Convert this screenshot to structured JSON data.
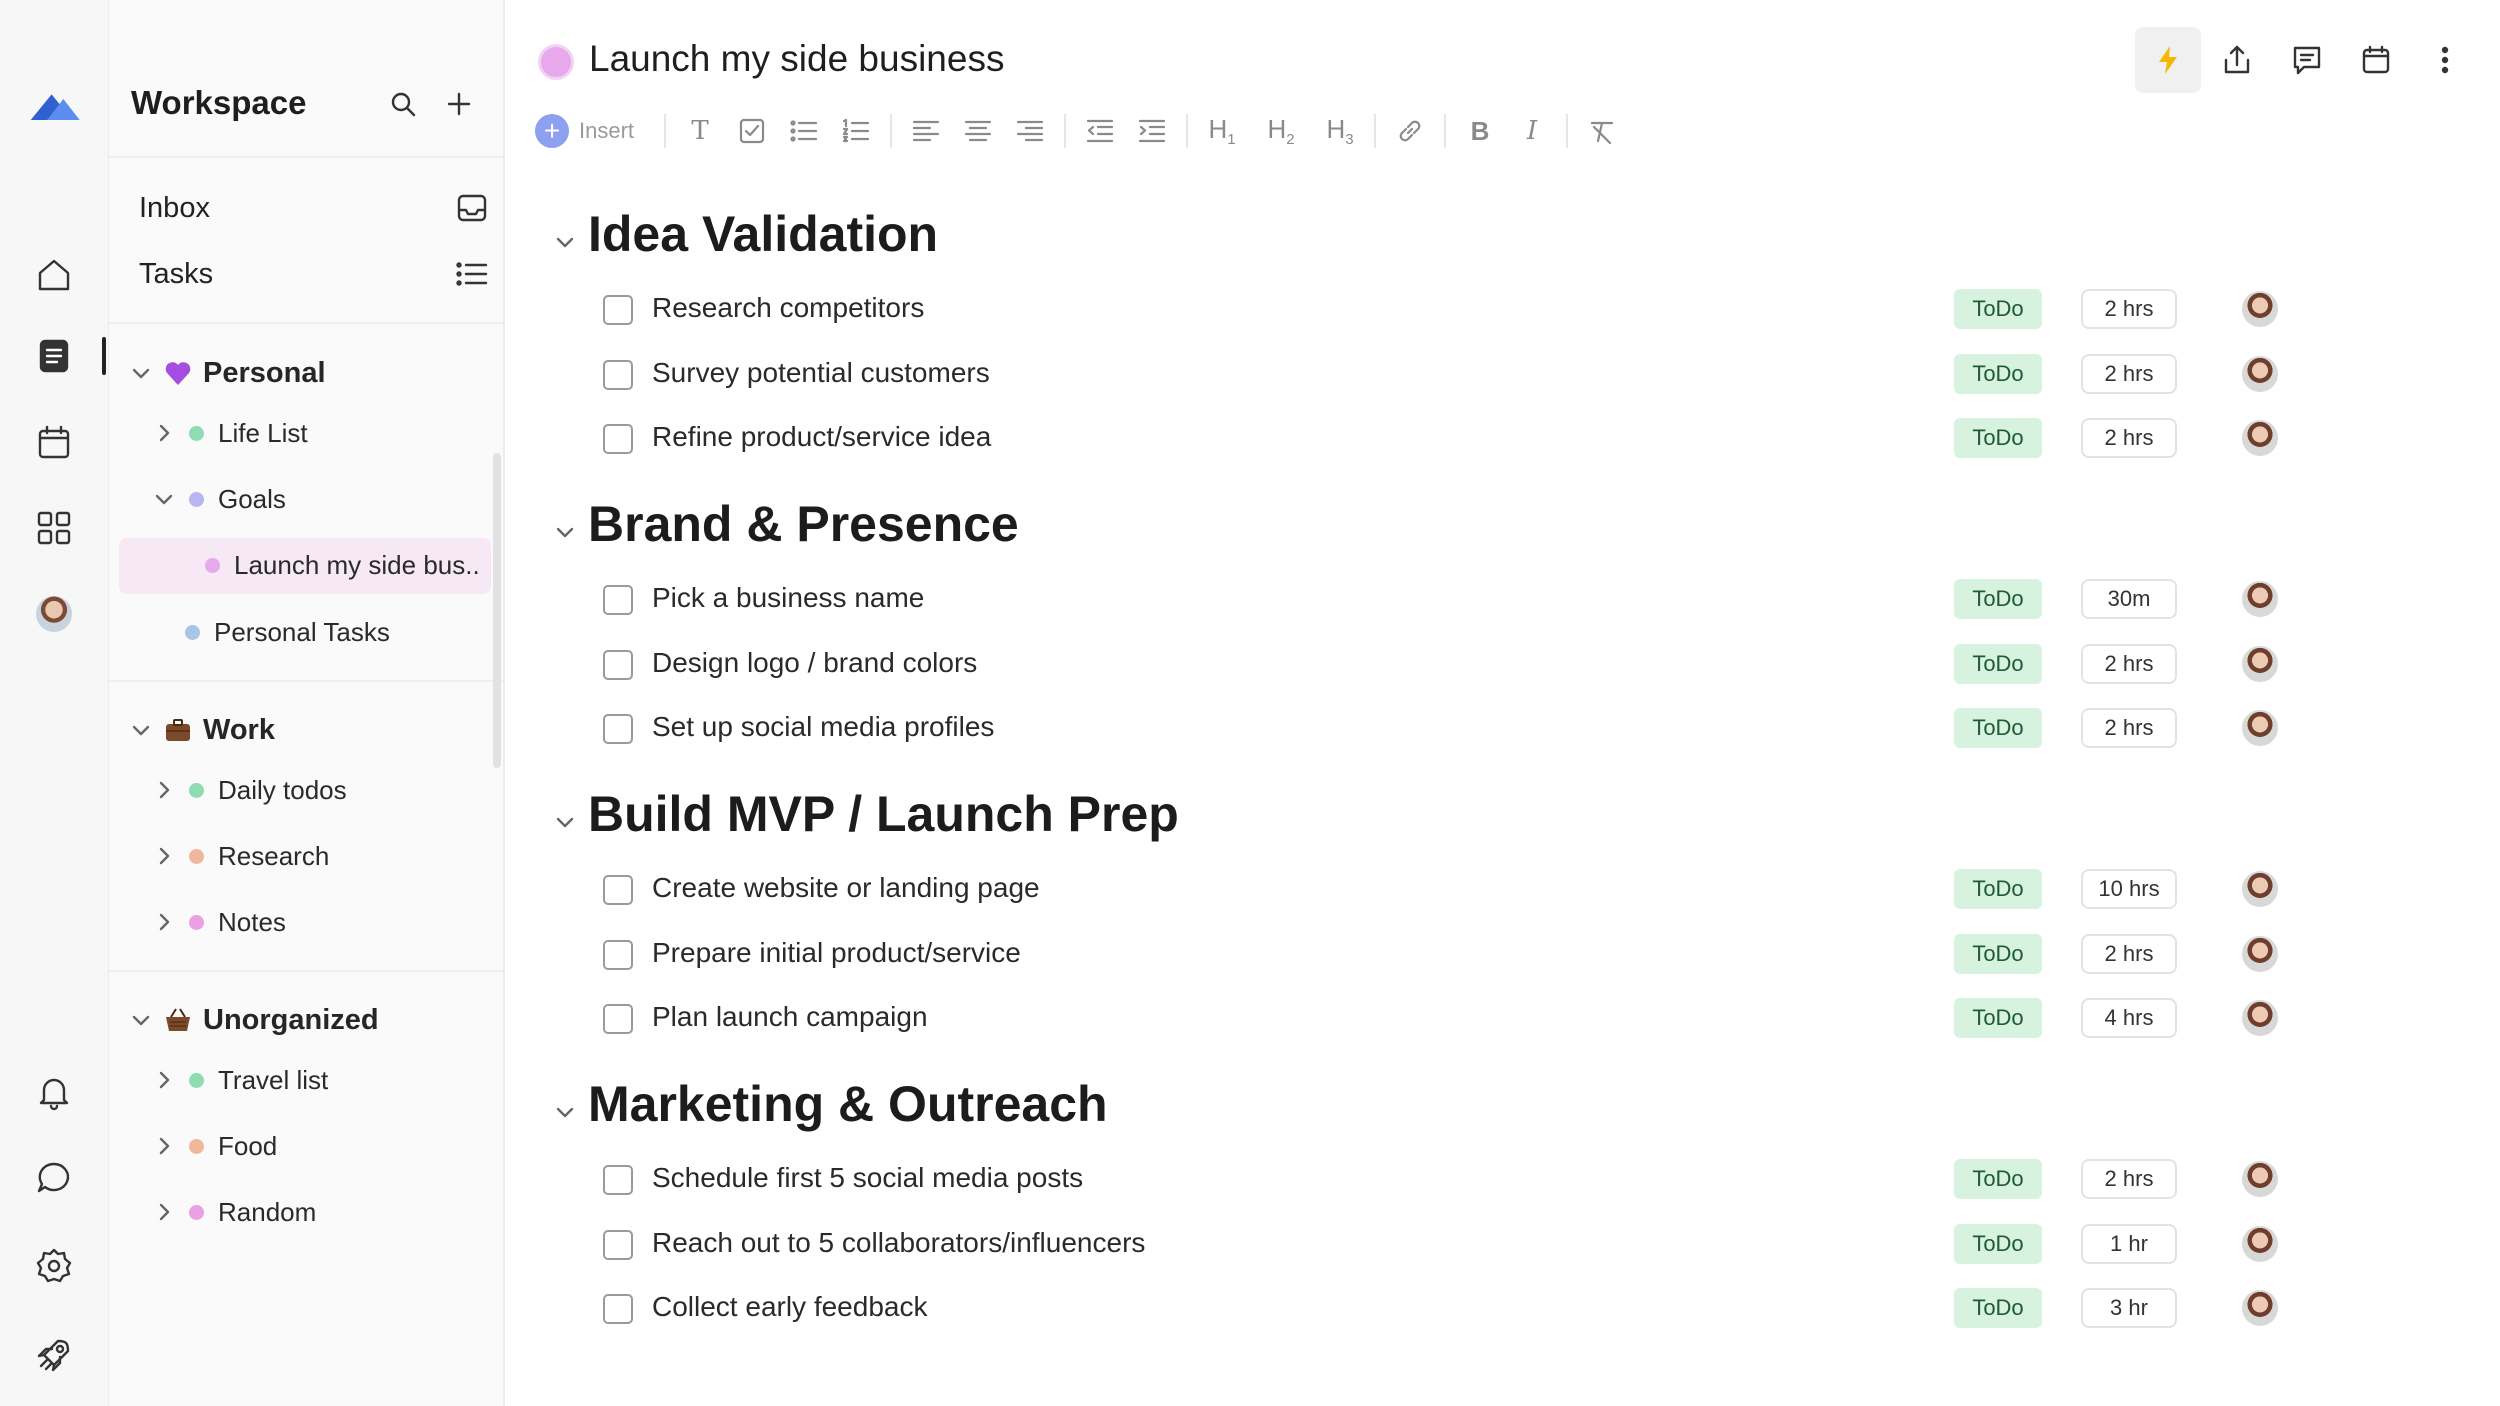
{
  "rail": {
    "icons": [
      "logo-icon",
      "home-icon",
      "document-icon",
      "calendar-icon",
      "grid-icon",
      "avatar",
      "bell-icon",
      "chat-icon",
      "gear-icon",
      "rocket-icon"
    ]
  },
  "sidebar": {
    "workspace_title": "Workspace",
    "inbox_label": "Inbox",
    "tasks_label": "Tasks",
    "sections": [
      {
        "label": "Personal",
        "emoji": "purple-heart-icon",
        "items": [
          {
            "label": "Life List",
            "color": "#8fdcb3"
          },
          {
            "label": "Goals",
            "color": "#b8b5f0"
          },
          {
            "label": "Launch my side bus..",
            "color": "#e7a8ec"
          },
          {
            "label": "Personal Tasks",
            "color": "#a9c6e8"
          }
        ]
      },
      {
        "label": "Work",
        "emoji": "briefcase-icon",
        "items": [
          {
            "label": "Daily todos",
            "color": "#8fdcb3"
          },
          {
            "label": "Research",
            "color": "#f0b79c"
          },
          {
            "label": "Notes",
            "color": "#eaa0e2"
          }
        ]
      },
      {
        "label": "Unorganized",
        "emoji": "basket-icon",
        "items": [
          {
            "label": "Travel list",
            "color": "#8fdcb3"
          },
          {
            "label": "Food",
            "color": "#f0b79c"
          },
          {
            "label": "Random",
            "color": "#eaa0e2"
          }
        ]
      }
    ]
  },
  "doc": {
    "title": "Launch my side business",
    "color": "#e7a8ec"
  },
  "toolbar": {
    "insert_label": "Insert",
    "h1": "H",
    "h1_sub": "1",
    "h2": "H",
    "h2_sub": "2",
    "h3": "H",
    "h3_sub": "3",
    "bold": "B",
    "italic": "I",
    "text": "T"
  },
  "sections": [
    {
      "title": "Idea Validation",
      "tasks": [
        {
          "title": "Research competitors",
          "status": "ToDo",
          "time": "2 hrs"
        },
        {
          "title": "Survey potential customers",
          "status": "ToDo",
          "time": "2 hrs"
        },
        {
          "title": "Refine product/service idea",
          "status": "ToDo",
          "time": "2 hrs"
        }
      ]
    },
    {
      "title": "Brand & Presence",
      "tasks": [
        {
          "title": "Pick a business name",
          "status": "ToDo",
          "time": "30m"
        },
        {
          "title": "Design logo / brand colors",
          "status": "ToDo",
          "time": "2 hrs"
        },
        {
          "title": "Set up social media profiles",
          "status": "ToDo",
          "time": "2 hrs"
        }
      ]
    },
    {
      "title": "Build MVP / Launch Prep",
      "tasks": [
        {
          "title": "Create website or landing page",
          "status": "ToDo",
          "time": "10 hrs"
        },
        {
          "title": "Prepare initial product/service",
          "status": "ToDo",
          "time": "2 hrs"
        },
        {
          "title": "Plan launch campaign",
          "status": "ToDo",
          "time": "4 hrs"
        }
      ]
    },
    {
      "title": "Marketing & Outreach",
      "tasks": [
        {
          "title": "Schedule first 5 social media posts",
          "status": "ToDo",
          "time": "2 hrs"
        },
        {
          "title": "Reach out to 5 collaborators/influencers",
          "status": "ToDo",
          "time": "1 hr"
        },
        {
          "title": "Collect early feedback",
          "status": "ToDo",
          "time": "3 hr"
        }
      ]
    }
  ],
  "colors": {
    "status_bg": "#d7f3df",
    "status_text": "#1e5a34",
    "selected_bg": "#f6e8f4",
    "accent": "#8ea0f0",
    "bolt": "#f5b800"
  }
}
